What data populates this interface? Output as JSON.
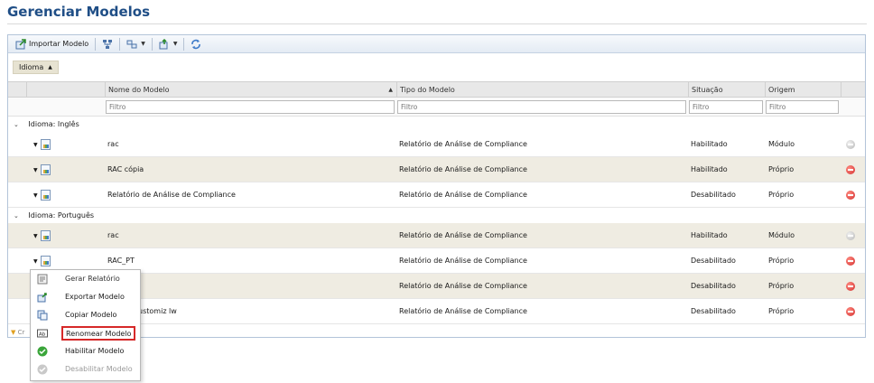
{
  "page": {
    "title": "Gerenciar Modelos"
  },
  "toolbar": {
    "import_label": "Importar Modelo",
    "icons": [
      "import-icon",
      "hierarchy-icon",
      "layout-icon",
      "export-icon",
      "refresh-icon"
    ]
  },
  "grouping": {
    "chip_label": "Idioma"
  },
  "table": {
    "columns": {
      "name": "Nome do Modelo",
      "type": "Tipo do Modelo",
      "status": "Situação",
      "origin": "Origem"
    },
    "filter_placeholder": "Filtro",
    "groups": [
      {
        "label": "Idioma: Inglês",
        "rows": [
          {
            "name": "rac",
            "type": "Relatório de Análise de Compliance",
            "status": "Habilitado",
            "origin": "Módulo",
            "action": "grey"
          },
          {
            "name": "RAC cópia",
            "type": "Relatório de Análise de Compliance",
            "status": "Habilitado",
            "origin": "Próprio",
            "action": "red"
          },
          {
            "name": "Relatório de Análise de Compliance",
            "type": "Relatório de Análise de Compliance",
            "status": "Desabilitado",
            "origin": "Próprio",
            "action": "red"
          }
        ]
      },
      {
        "label": "Idioma: Português",
        "rows": [
          {
            "name": "rac",
            "type": "Relatório de Análise de Compliance",
            "status": "Habilitado",
            "origin": "Módulo",
            "action": "grey"
          },
          {
            "name": "RAC_PT",
            "type": "Relatório de Análise de Compliance",
            "status": "Desabilitado",
            "origin": "Próprio",
            "action": "red"
          },
          {
            "name": "1",
            "type": "Relatório de Análise de Compliance",
            "status": "Desabilitado",
            "origin": "Próprio",
            "action": "red"
          },
          {
            "name": "1 customiz lw",
            "type": "Relatório de Análise de Compliance",
            "status": "Desabilitado",
            "origin": "Próprio",
            "action": "red"
          }
        ]
      }
    ],
    "footer_text": "Cr"
  },
  "context_menu": {
    "items": [
      {
        "label": "Gerar Relatório",
        "icon": "report-icon",
        "state": "header"
      },
      {
        "label": "Exportar Modelo",
        "icon": "export-model-icon",
        "state": "enabled"
      },
      {
        "label": "Copiar Modelo",
        "icon": "copy-icon",
        "state": "enabled"
      },
      {
        "label": "Renomear Modelo",
        "icon": "rename-icon",
        "state": "selected"
      },
      {
        "label": "Habilitar Modelo",
        "icon": "enable-check-icon",
        "state": "enabled"
      },
      {
        "label": "Desabilitar Modelo",
        "icon": "disable-check-icon",
        "state": "disabled"
      }
    ]
  },
  "colors": {
    "title": "#1f4e86",
    "row_alt": "#efece2",
    "delete": "#d32f2f",
    "highlight_border": "#d62828"
  }
}
